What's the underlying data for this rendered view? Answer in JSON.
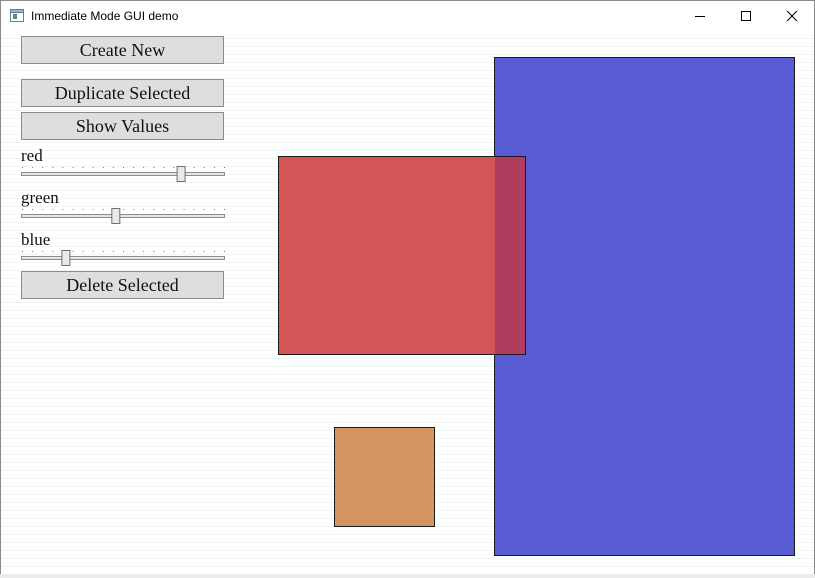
{
  "window": {
    "title": "Immediate Mode GUI demo"
  },
  "toolbar": {
    "create_label": "Create New",
    "duplicate_label": "Duplicate Selected",
    "show_values_label": "Show Values",
    "delete_label": "Delete Selected"
  },
  "sliders": [
    {
      "label": "red",
      "value": 0.8
    },
    {
      "label": "green",
      "value": 0.46
    },
    {
      "label": "blue",
      "value": 0.2
    }
  ],
  "icons": {
    "app": "window-app-icon",
    "minimize": "minimize-icon",
    "maximize": "maximize-icon",
    "close": "close-icon"
  },
  "shapes": {
    "blue_rect_color": "#5a5cd4",
    "red_rect_color": "#d35555",
    "overlap_color": "#b03c5e",
    "orange_square_color": "#d39660"
  }
}
